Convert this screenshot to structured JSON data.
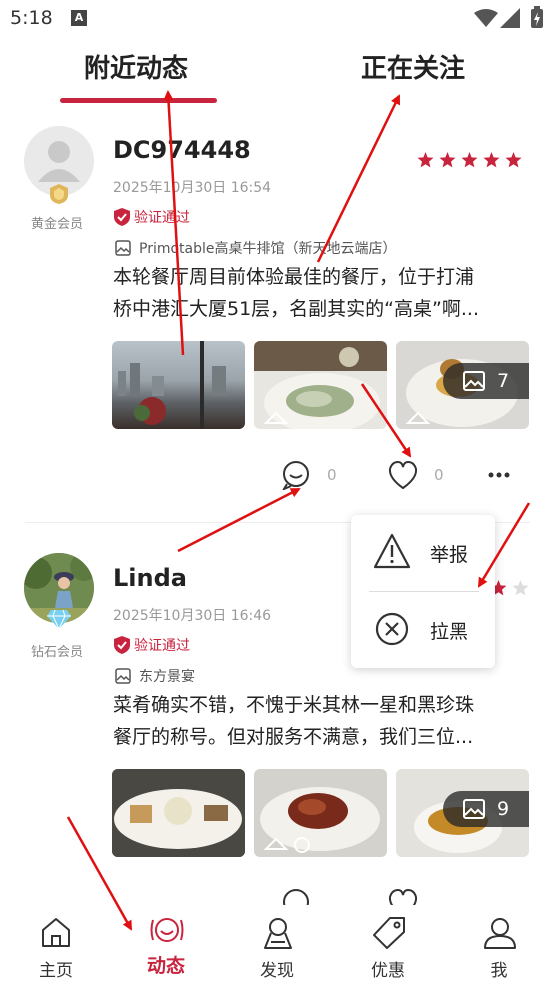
{
  "status_bar": {
    "time": "5:18",
    "notification_icon": "A"
  },
  "tabs": [
    {
      "label": "附近动态",
      "active": true
    },
    {
      "label": "正在关注",
      "active": false
    }
  ],
  "posts": [
    {
      "username": "DC974448",
      "member_level": "黄金会员",
      "time": "2025年10月30日 16:54",
      "verified_label": "验证通过",
      "restaurant": "Primotable高桌牛排馆（新天地云端店）",
      "text_line1": "本轮餐厅周目前体验最佳的餐厅，位于打浦",
      "text_line2": "桥中港汇大厦51层，名副其实的“高桌”啊...",
      "photo_count": "7",
      "comment_count": "0",
      "like_count": "0",
      "rating": 5
    },
    {
      "username": "Linda",
      "member_level": "钻石会员",
      "time": "2025年10月30日 16:46",
      "verified_label": "验证通过",
      "restaurant": "东方景宴",
      "text_line1": "菜肴确实不错，不愧于米其林一星和黑珍珠",
      "text_line2": "餐厅的称号。但对服务不满意，我们三位...",
      "photo_count": "9"
    }
  ],
  "popup_menu": {
    "report": "举报",
    "block": "拉黑"
  },
  "bottom_nav": [
    {
      "label": "主页",
      "icon": "home-icon"
    },
    {
      "label": "动态",
      "icon": "moments-icon",
      "active": true
    },
    {
      "label": "发现",
      "icon": "discover-icon"
    },
    {
      "label": "优惠",
      "icon": "coupon-tag-icon"
    },
    {
      "label": "我",
      "icon": "profile-icon"
    }
  ],
  "colors": {
    "accent": "#c8243e",
    "arrow": "#e01010"
  }
}
